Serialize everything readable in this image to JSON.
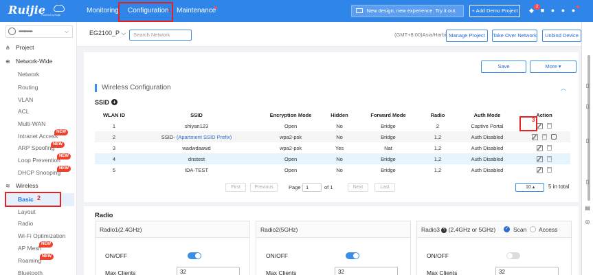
{
  "header": {
    "logo_brand": "Ruijie",
    "logo_sub": "Powered by Ruijie",
    "nav": [
      "Monitoring",
      "Configuration",
      "Maintenance"
    ],
    "banner": "New design, new experience. Try it out.",
    "demo_button": "+ Add Demo Project",
    "notification_count": "2",
    "icons": [
      "bell-icon",
      "box-icon",
      "help-icon",
      "globe-icon",
      "user-icon"
    ]
  },
  "annotations": {
    "one": "1",
    "two": "2",
    "three": "3"
  },
  "sidebar": {
    "user": "•••••••••••",
    "project": "Project",
    "network_wide": "Network-Wide",
    "network_items": [
      "Network",
      "Routing",
      "VLAN",
      "ACL",
      "Multi-WAN",
      "Intranet Access",
      "ARP Spoofing",
      "Loop Prevention",
      "DHCP Snooping"
    ],
    "new_badge": "NEW",
    "wireless": "Wireless",
    "wireless_items": [
      "Basic",
      "Layout",
      "Radio",
      "Wi-Fi Optimization",
      "AP Mesh",
      "Roaming",
      "Bluetooth"
    ]
  },
  "subbar": {
    "device": "EG2100_P",
    "search_placeholder": "Search Network",
    "timezone": "(GMT+8:00)Asia/Harbin",
    "buttons": [
      "Manage Project",
      "Take Over Network",
      "Unbind Device"
    ]
  },
  "main": {
    "save": "Save",
    "more": "More ▾",
    "section_title": "Wireless Configuration",
    "collapse_icon": "chevron-up-icon",
    "ssid_heading": "SSID",
    "columns": [
      "WLAN ID",
      "SSID",
      "Encryption Mode",
      "Hidden",
      "Forward Mode",
      "Radio",
      "Auth Mode",
      "Action"
    ],
    "rows": [
      {
        "id": "1",
        "ssid": "shiyan123",
        "ssid_extra": "",
        "enc": "Open",
        "hidden": "No",
        "forward": "Bridge",
        "radio": "2",
        "auth": "Captive Portal"
      },
      {
        "id": "2",
        "ssid": "SSID- ",
        "ssid_extra": "(Apartment SSID Prefix)",
        "enc": "wpa2-psk",
        "hidden": "No",
        "forward": "Bridge",
        "radio": "1,2",
        "auth": "Auth Disabled"
      },
      {
        "id": "3",
        "ssid": "wadwdaawd",
        "ssid_extra": "",
        "enc": "wpa2-psk",
        "hidden": "Yes",
        "forward": "Nat",
        "radio": "1,2",
        "auth": "Auth Disabled"
      },
      {
        "id": "4",
        "ssid": "dnstest",
        "ssid_extra": "",
        "enc": "Open",
        "hidden": "No",
        "forward": "Bridge",
        "radio": "1,2",
        "auth": "Auth Disabled"
      },
      {
        "id": "5",
        "ssid": "IDA-TEST",
        "ssid_extra": "",
        "enc": "Open",
        "hidden": "No",
        "forward": "Bridge",
        "radio": "1,2",
        "auth": "Auth Disabled"
      }
    ],
    "pager": {
      "first": "First",
      "previous": "Previous",
      "page_label": "Page",
      "page": "1",
      "of": "of 1",
      "next": "Next",
      "last": "Last",
      "page_size": "10 ▴",
      "total": "5 in total"
    }
  },
  "radio": {
    "heading": "Radio",
    "cards": [
      {
        "title": "Radio1(2.4GHz)",
        "onoff_label": "ON/OFF",
        "enabled": true,
        "max_clients_label": "Max Clients",
        "max_clients": "32"
      },
      {
        "title": "Radio2(5GHz)",
        "onoff_label": "ON/OFF",
        "enabled": true,
        "max_clients_label": "Max Clients",
        "max_clients": "32"
      },
      {
        "title": "Radio3",
        "title_extra": "(2.4GHz or 5GHz)",
        "onoff_label": "ON/OFF",
        "enabled": false,
        "max_clients_label": "Max Clients",
        "max_clients": "32",
        "scan": "Scan",
        "access": "Access"
      }
    ]
  },
  "colors": {
    "primary": "#2f86e8",
    "accent": "#3a8ee6",
    "badge": "#f0412e",
    "highlight": "#e52222"
  }
}
